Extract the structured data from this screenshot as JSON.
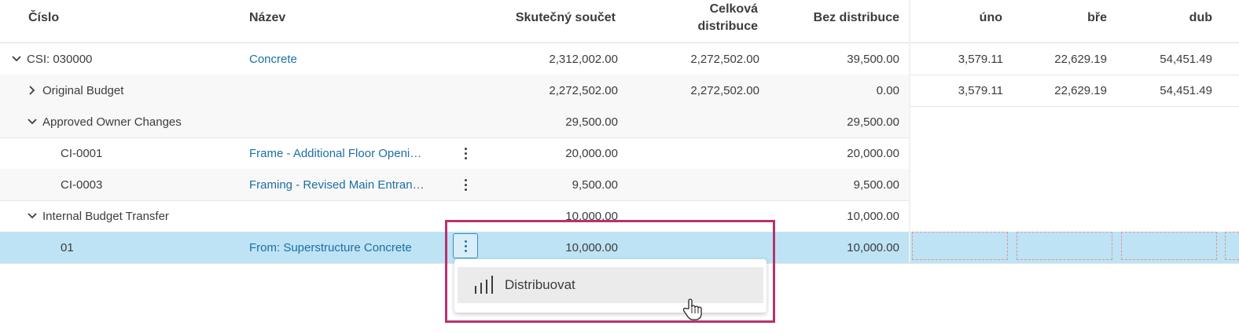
{
  "headers": {
    "cislo": "Číslo",
    "nazev": "Název",
    "skutecny": "Skutečný součet",
    "celkova_1": "Celková",
    "celkova_2": "distribuce",
    "bez": "Bez distribuce",
    "uno": "úno",
    "bre": "bře",
    "dub": "dub"
  },
  "rows": [
    {
      "cislo": "CSI: 030000",
      "nazev": "Concrete",
      "skutecny": "2,312,002.00",
      "celkova": "2,272,502.00",
      "bez": "39,500.00",
      "uno": "3,579.11",
      "bre": "22,629.19",
      "dub": "54,451.49"
    },
    {
      "cislo": "Original Budget",
      "nazev": "",
      "skutecny": "2,272,502.00",
      "celkova": "2,272,502.00",
      "bez": "0.00",
      "uno": "3,579.11",
      "bre": "22,629.19",
      "dub": "54,451.49"
    },
    {
      "cislo": "Approved Owner Changes",
      "nazev": "",
      "skutecny": "29,500.00",
      "celkova": "",
      "bez": "29,500.00"
    },
    {
      "cislo": "CI-0001",
      "nazev": "Frame - Additional Floor Openi…",
      "skutecny": "20,000.00",
      "celkova": "",
      "bez": "20,000.00"
    },
    {
      "cislo": "CI-0003",
      "nazev": "Framing - Revised Main Entran…",
      "skutecny": "9,500.00",
      "celkova": "",
      "bez": "9,500.00"
    },
    {
      "cislo": "Internal Budget Transfer",
      "nazev": "",
      "skutecny": "10,000.00",
      "celkova": "",
      "bez": "10,000.00"
    },
    {
      "cislo": "01",
      "nazev": "From: Superstructure Concrete",
      "skutecny": "10,000.00",
      "celkova": "",
      "bez": "10,000.00"
    }
  ],
  "menu": {
    "distribute_label": "Distribuovat",
    "distribute_icon": "bar-chart-icon"
  },
  "colors": {
    "link": "#1c6ea4",
    "selected_row": "#bde3f4",
    "highlight_border": "#b8326e"
  }
}
